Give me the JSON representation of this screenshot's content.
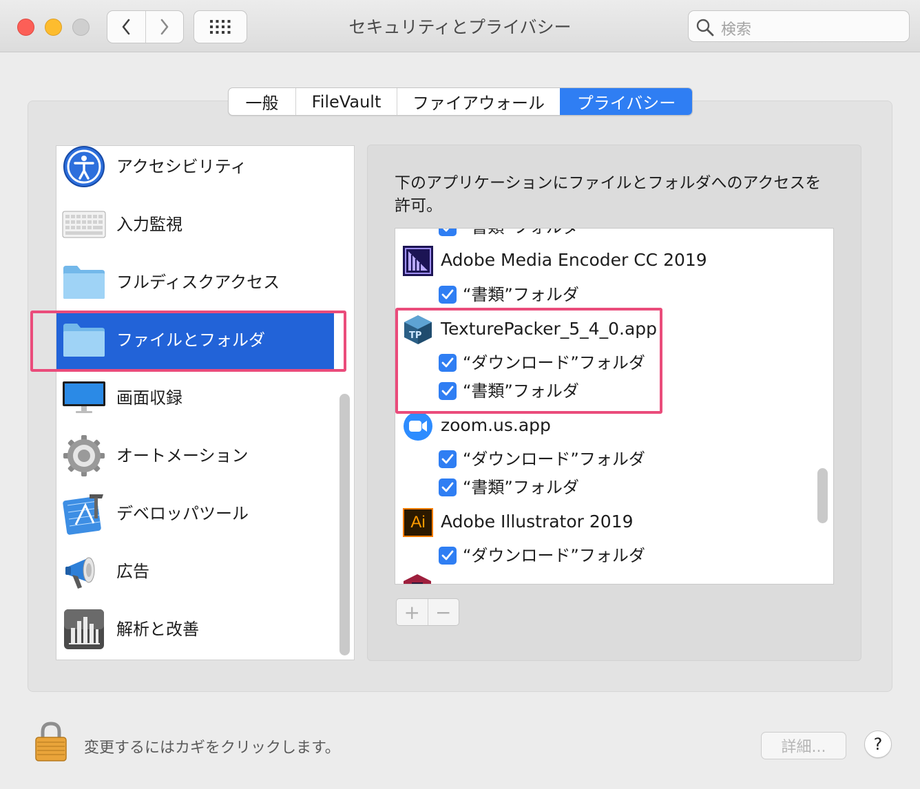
{
  "window": {
    "title": "セキュリティとプライバシー",
    "search_placeholder": "検索"
  },
  "tabs": [
    {
      "label": "一般",
      "active": false
    },
    {
      "label": "FileVault",
      "active": false
    },
    {
      "label": "ファイアウォール",
      "active": false
    },
    {
      "label": "プライバシー",
      "active": true
    }
  ],
  "categories": [
    {
      "label": "アクセシビリティ",
      "icon": "accessibility-icon",
      "selected": false
    },
    {
      "label": "入力監視",
      "icon": "keyboard-icon",
      "selected": false
    },
    {
      "label": "フルディスクアクセス",
      "icon": "folder-icon",
      "selected": false
    },
    {
      "label": "ファイルとフォルダ",
      "icon": "folder-icon",
      "selected": true
    },
    {
      "label": "画面収録",
      "icon": "display-icon",
      "selected": false
    },
    {
      "label": "オートメーション",
      "icon": "gear-icon",
      "selected": false
    },
    {
      "label": "デベロッパツール",
      "icon": "xcode-icon",
      "selected": false
    },
    {
      "label": "広告",
      "icon": "megaphone-icon",
      "selected": false
    },
    {
      "label": "解析と改善",
      "icon": "analytics-icon",
      "selected": false
    }
  ],
  "description": "下のアプリケーションにファイルとフォルダへのアクセスを許可。",
  "app_list": {
    "partial_top_label": "“書類”フォルダ",
    "apps": [
      {
        "name": "Adobe Media Encoder CC 2019",
        "icon": "media-encoder-icon",
        "permissions": [
          {
            "label": "“書類”フォルダ",
            "checked": true
          }
        ]
      },
      {
        "name": "TexturePacker_5_4_0.app",
        "icon": "texturepacker-icon",
        "permissions": [
          {
            "label": "“ダウンロード”フォルダ",
            "checked": true
          },
          {
            "label": "“書類”フォルダ",
            "checked": true
          }
        ]
      },
      {
        "name": "zoom.us.app",
        "icon": "zoom-icon",
        "permissions": [
          {
            "label": "“ダウンロード”フォルダ",
            "checked": true
          },
          {
            "label": "“書類”フォルダ",
            "checked": true
          }
        ]
      },
      {
        "name": "Adobe Illustrator 2019",
        "icon": "illustrator-icon",
        "icon_text": "Ai",
        "permissions": [
          {
            "label": "“ダウンロード”フォルダ",
            "checked": true
          }
        ]
      }
    ]
  },
  "buttons": {
    "add": "+",
    "remove": "−",
    "details": "詳細...",
    "help": "?"
  },
  "footer": {
    "lock_text": "変更するにはカギをクリックします。"
  },
  "colors": {
    "accent": "#2f7ef3",
    "selection": "#2263d8",
    "highlight_box": "#ea4c7b"
  }
}
